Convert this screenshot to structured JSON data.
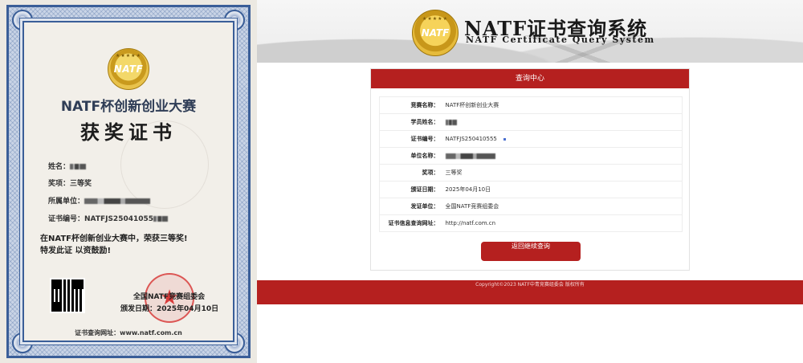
{
  "certificate": {
    "logo_text": "NATF",
    "title": "NATF杯创新创业大赛",
    "subtitle": "获奖证书",
    "name_label": "姓名：",
    "award_label": "奖项：",
    "award_value": "三等奖",
    "unit_label": "所属单位：",
    "cert_no_label": "证书编号：",
    "cert_no_value": "NATFJS25041055",
    "award_text_line1": "在NATF杯创新创业大赛中，荣获三等奖!",
    "award_text_line2": "特发此证 以资鼓励!",
    "issuer": "全国NATF竞赛组委会",
    "issue_date": "颁发日期：2025年04月10日",
    "query_url": "证书查询网址：www.natf.com.cn"
  },
  "site": {
    "logo_text": "NATF",
    "title": "NATF证书查询系统",
    "title_en": "NATF Certificate Query System",
    "panel_title": "查询中心",
    "fields": [
      {
        "label": "竞赛名称：",
        "value": "NATF杯创新创业大赛"
      },
      {
        "label": "学员姓名：",
        "value": ""
      },
      {
        "label": "证书编号：",
        "value": "NATFJS250410555"
      },
      {
        "label": "单位名称：",
        "value": ""
      },
      {
        "label": "奖项：",
        "value": "三等奖"
      },
      {
        "label": "颁证日期：",
        "value": "2025年04月10日"
      },
      {
        "label": "发证单位：",
        "value": "全国NATF竞赛组委会"
      },
      {
        "label": "证书信息查询网址：",
        "value": "http://natf.com.cn"
      }
    ],
    "back_button": "返回继续查询",
    "footer": "Copyright©2023 NATF中青竞赛组委会 版权所有",
    "colors": {
      "brand_red": "#b5201f",
      "seal_red": "#d62828",
      "frame_blue": "#3a5e98",
      "gold": "#c8971a"
    }
  }
}
